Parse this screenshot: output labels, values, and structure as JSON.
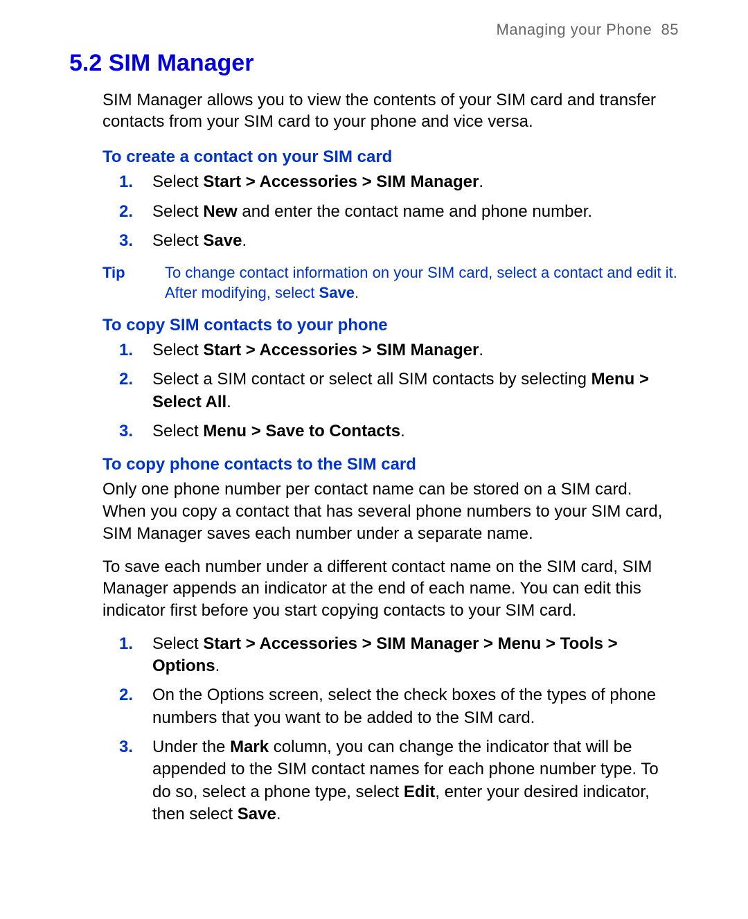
{
  "header": {
    "running_title": "Managing your Phone",
    "page_number": "85"
  },
  "section": {
    "number": "5.2",
    "title": "SIM Manager"
  },
  "intro": "SIM Manager allows you to view the contents of your SIM card and transfer contacts from your SIM card to your phone and vice versa.",
  "sub1": {
    "heading": "To create a contact on your SIM card",
    "steps": [
      {
        "pre": "Select ",
        "bold": "Start > Accessories > SIM Manager",
        "post": "."
      },
      {
        "pre": "Select ",
        "bold": "New",
        "post": " and enter the contact name and phone number."
      },
      {
        "pre": "Select ",
        "bold": "Save",
        "post": "."
      }
    ]
  },
  "tip": {
    "label": "Tip",
    "text_pre": "To change contact information on your SIM card, select a contact and edit it. After modifying, select ",
    "text_bold": "Save",
    "text_post": "."
  },
  "sub2": {
    "heading": "To copy SIM contacts to your phone",
    "steps": [
      {
        "pre": "Select ",
        "bold": "Start > Accessories > SIM Manager",
        "post": "."
      },
      {
        "pre": "Select a SIM contact or select all SIM contacts by selecting ",
        "bold": "Menu > Select All",
        "post": "."
      },
      {
        "pre": "Select ",
        "bold": "Menu > Save to Contacts",
        "post": "."
      }
    ]
  },
  "sub3": {
    "heading": "To copy phone contacts to the SIM card",
    "para1": "Only one phone number per contact name can be stored on a SIM card. When you copy a contact that has several phone numbers to your SIM card, SIM Manager saves each number under a separate name.",
    "para2": "To save each number under a different contact name on the SIM card, SIM Manager appends an indicator at the end of each name. You can edit this indicator first before you start copying contacts to your SIM card.",
    "steps": [
      {
        "pre": "Select ",
        "bold": "Start > Accessories > SIM Manager > Menu > Tools > Options",
        "post": "."
      },
      {
        "pre": "On the Options screen, select the check boxes of the types of phone numbers that you want to be added to the SIM card.",
        "bold": "",
        "post": ""
      },
      {
        "parts": [
          {
            "t": "Under the "
          },
          {
            "t": "Mark",
            "b": true
          },
          {
            "t": " column, you can change the indicator that will be appended to the SIM contact names for each phone number type. To do so, select a phone type, select "
          },
          {
            "t": "Edit",
            "b": true
          },
          {
            "t": ", enter your desired indicator, then select "
          },
          {
            "t": "Save",
            "b": true
          },
          {
            "t": "."
          }
        ]
      }
    ]
  }
}
